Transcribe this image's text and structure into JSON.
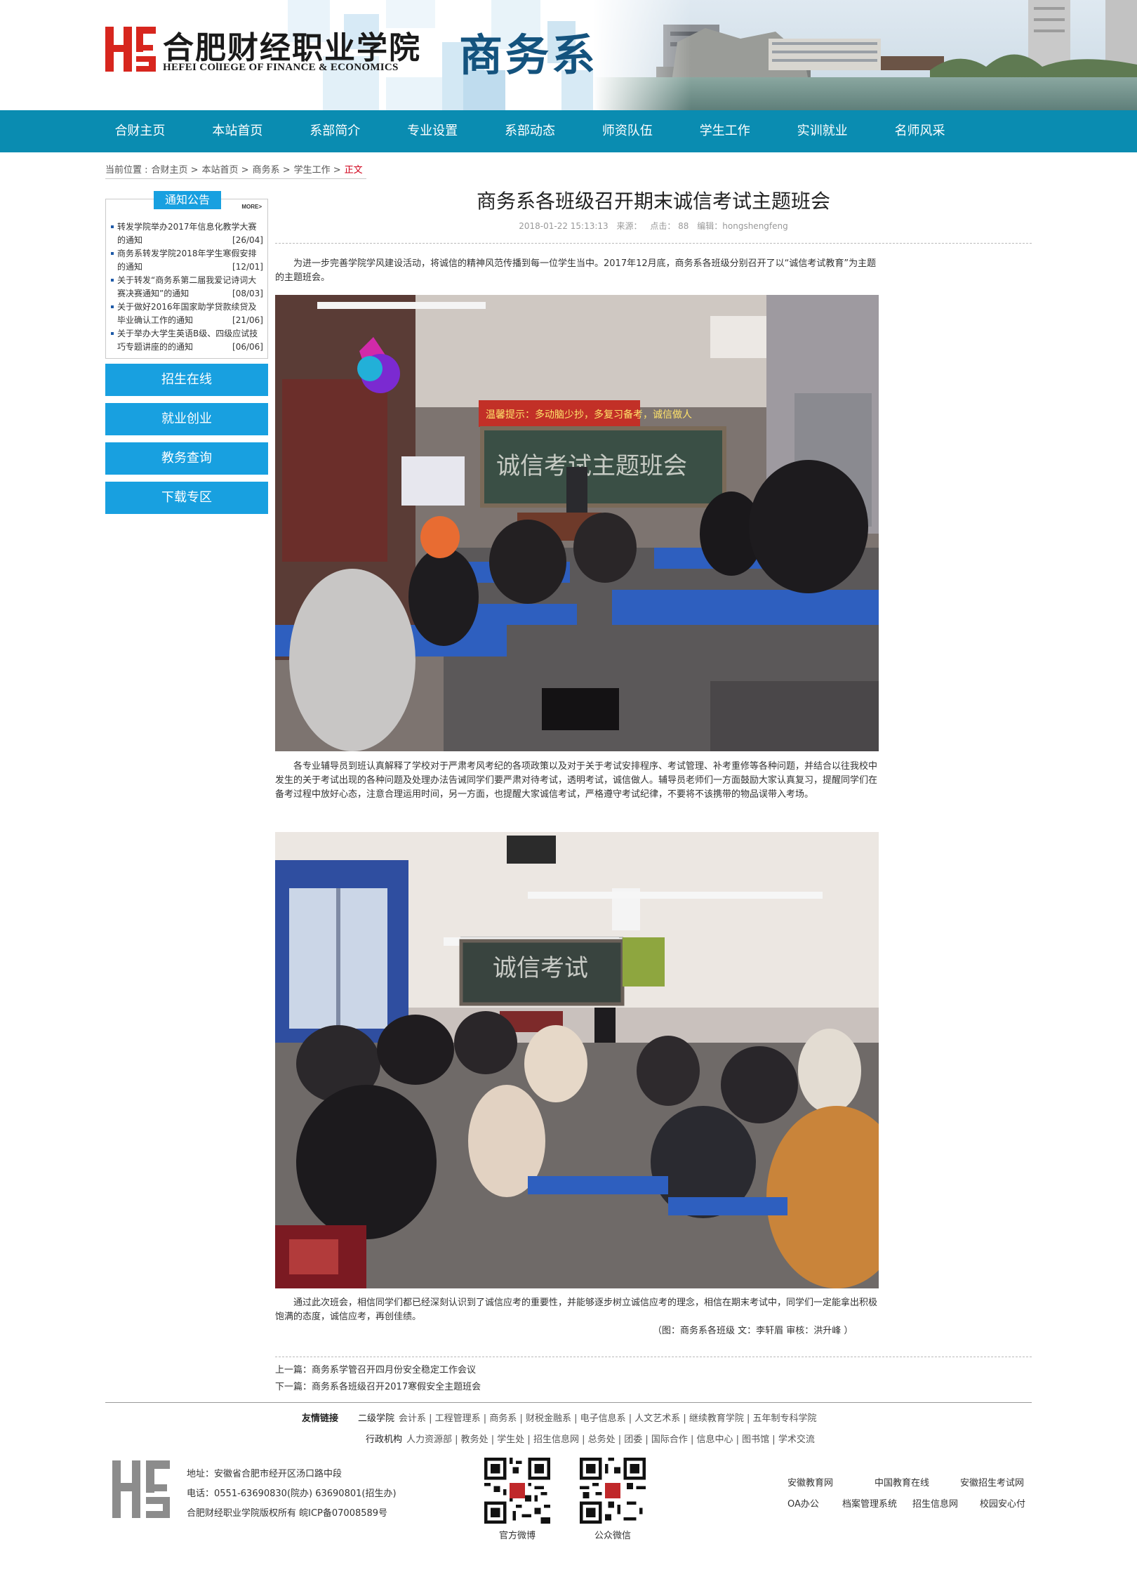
{
  "header": {
    "college_cn": "合肥财经职业学院",
    "college_en": "HEFEI COlIEGE OF FINANCE & ECONOMICS",
    "dept": "商务系"
  },
  "nav": [
    "合财主页",
    "本站首页",
    "系部简介",
    "专业设置",
    "系部动态",
    "师资队伍",
    "学生工作",
    "实训就业",
    "名师风采"
  ],
  "breadcrumb": {
    "label": "当前位置 :",
    "items": [
      "合财主页 >",
      "本站首页 >",
      "商务系 >",
      "学生工作 >"
    ],
    "current": "正文"
  },
  "notice": {
    "title": "通知公告",
    "more": "MORE>",
    "items": [
      {
        "text": "转发学院举办2017年信息化教学大赛的通知",
        "date": "[26/04]"
      },
      {
        "text": "商务系转发学院2018年学生寒假安排的通知",
        "date": "[12/01]"
      },
      {
        "text": "关于转发“商务系第二届我爱记诗词大赛决赛通知”的通知",
        "date": "[08/03]"
      },
      {
        "text": "关于做好2016年国家助学贷款续贷及毕业确认工作的通知",
        "date": "[21/06]"
      },
      {
        "text": "关于举办大学生英语B级、四级应试技巧专题讲座的的通知",
        "date": "[06/06]"
      }
    ]
  },
  "side_buttons": [
    "招生在线",
    "就业创业",
    "教务查询",
    "下载专区"
  ],
  "article": {
    "title": "商务系各班级召开期末诚信考试主题班会",
    "date": "2018-01-22 15:13:13",
    "source": "来源：",
    "hits": "点击： 88",
    "editor": "编辑：hongshengfeng",
    "p1": "为进一步完善学院学风建设活动，将诚信的精神风范传播到每一位学生当中。2017年12月底，商务系各班级分别召开了以“诚信考试教育”为主题的主题班会。",
    "p2": "各专业辅导员到班认真解释了学校对于严肃考风考纪的各项政策以及对于关于考试安排程序、考试管理、补考重修等各种问题，并结合以往我校中发生的关于考试出现的各种问题及处理办法告诫同学们要严肃对待考试，透明考试，诚信做人。辅导员老师们一方面鼓励大家认真复习，提醒同学们在备考过程中放好心态，注意合理运用时间，另一方面，也提醒大家诚信考试，严格遵守考试纪律，不要将不该携带的物品误带入考场。",
    "p3": "通过此次班会，相信同学们都已经深刻认识到了诚信应考的重要性，并能够逐步树立诚信应考的理念，相信在期末考试中，同学们一定能拿出积极饱满的态度，诚信应考，再创佳绩。",
    "credit": "（图：商务系各班级   文：李轩眉   审核：洪升峰 ）",
    "board1": "诚信考试主题班会",
    "board2": "诚信考试",
    "banner": "温馨提示：多动脑少抄，多复习备考，诚信做人"
  },
  "prevnext": {
    "prev_label": "上一篇：",
    "prev": "商务系学管召开四月份安全稳定工作会议",
    "next_label": "下一篇：",
    "next": "商务系各班级召开2017寒假安全主题班会"
  },
  "footer": {
    "links_label": "友情链接",
    "cat1": "二级学院",
    "row1": "会计系 | 工程管理系 | 商务系 | 财税金融系 | 电子信息系 | 人文艺术系 | 继续教育学院 | 五年制专科学院",
    "cat2": "行政机构",
    "row2": "人力资源部 | 教务处 | 学生处 | 招生信息网 | 总务处 | 团委 | 国际合作 | 信息中心 | 图书馆 | 学术交流",
    "address": "地址：安徽省合肥市经开区汤口路中段",
    "phone": "电话：0551-63690830(院办)    63690801(招生办)",
    "copyright": "合肥财经职业学院版权所有 皖ICP备07008589号",
    "qr1": "官方微博",
    "qr2": "公众微信",
    "ext": [
      "安徽教育网",
      "中国教育在线",
      "安徽招生考试网",
      "OA办公",
      "档案管理系统",
      "招生信息网",
      "校园安心付"
    ]
  },
  "colors": {
    "nav_bg": "#0a8cb1",
    "accent_blue": "#18a0e0",
    "dept_text": "#14537e",
    "logo_red": "#d7261e",
    "breadcrumb_current": "#d0021b"
  }
}
